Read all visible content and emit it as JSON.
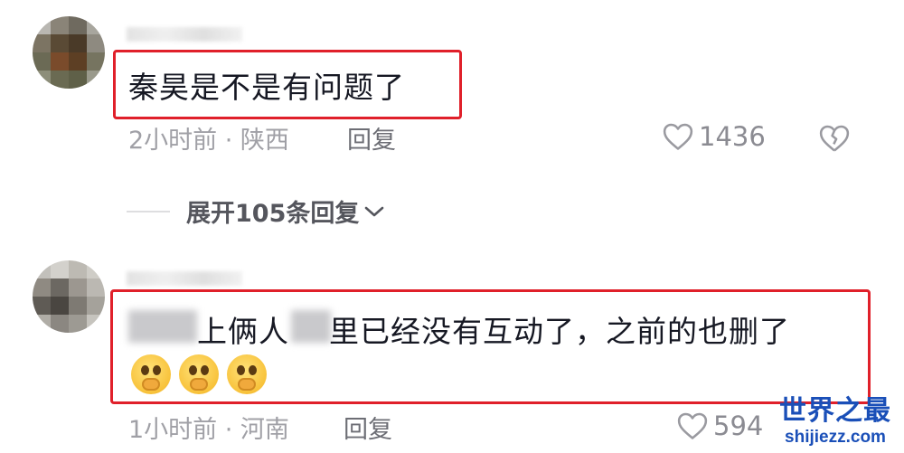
{
  "comments": [
    {
      "text": "秦昊是不是有问题了",
      "time_location": "2小时前 · 陕西",
      "reply_label": "回复",
      "likes": "1436"
    },
    {
      "text_visible": "上俩人",
      "text_visible_2": "里已经没有互动了，之前的也删了",
      "emoji_count": 3,
      "time_location": "1小时前 · 河南",
      "reply_label": "回复",
      "likes": "594"
    }
  ],
  "expand_replies": "展开105条回复",
  "watermark": {
    "title": "世界之最",
    "url": "shijiezz.com"
  },
  "colors": {
    "highlight_border": "#e0202a",
    "watermark_blue": "#1a4fb8"
  },
  "icons": [
    "heart-outline-icon",
    "broken-heart-icon",
    "chevron-down-icon",
    "covering-mouth-emoji"
  ]
}
